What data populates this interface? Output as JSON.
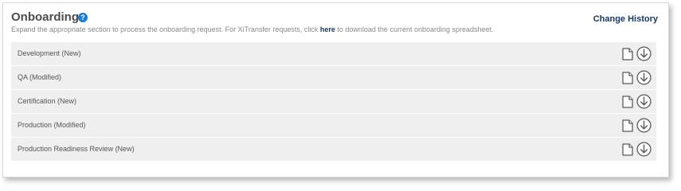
{
  "header": {
    "title": "Onboarding",
    "help_icon": "question-circle-icon",
    "help_glyph": "?",
    "change_history_label": "Change History"
  },
  "subtitle": {
    "before": "Expand the appropriate section to process the onboarding request. For XiTransfer requests, click ",
    "link": "here",
    "after": " to download the current onboarding spreadsheet."
  },
  "sections": [
    {
      "label": "Development (New)"
    },
    {
      "label": "QA (Modified)"
    },
    {
      "label": "Certification (New)"
    },
    {
      "label": "Production (Modified)"
    },
    {
      "label": "Production Readiness Review (New)"
    }
  ],
  "row_icons": {
    "document": "document-icon",
    "download": "download-circle-icon"
  },
  "colors": {
    "link": "#163a66",
    "help": "#1a7fd0",
    "row_bg": "#efefef",
    "title": "#4d4d4d"
  }
}
